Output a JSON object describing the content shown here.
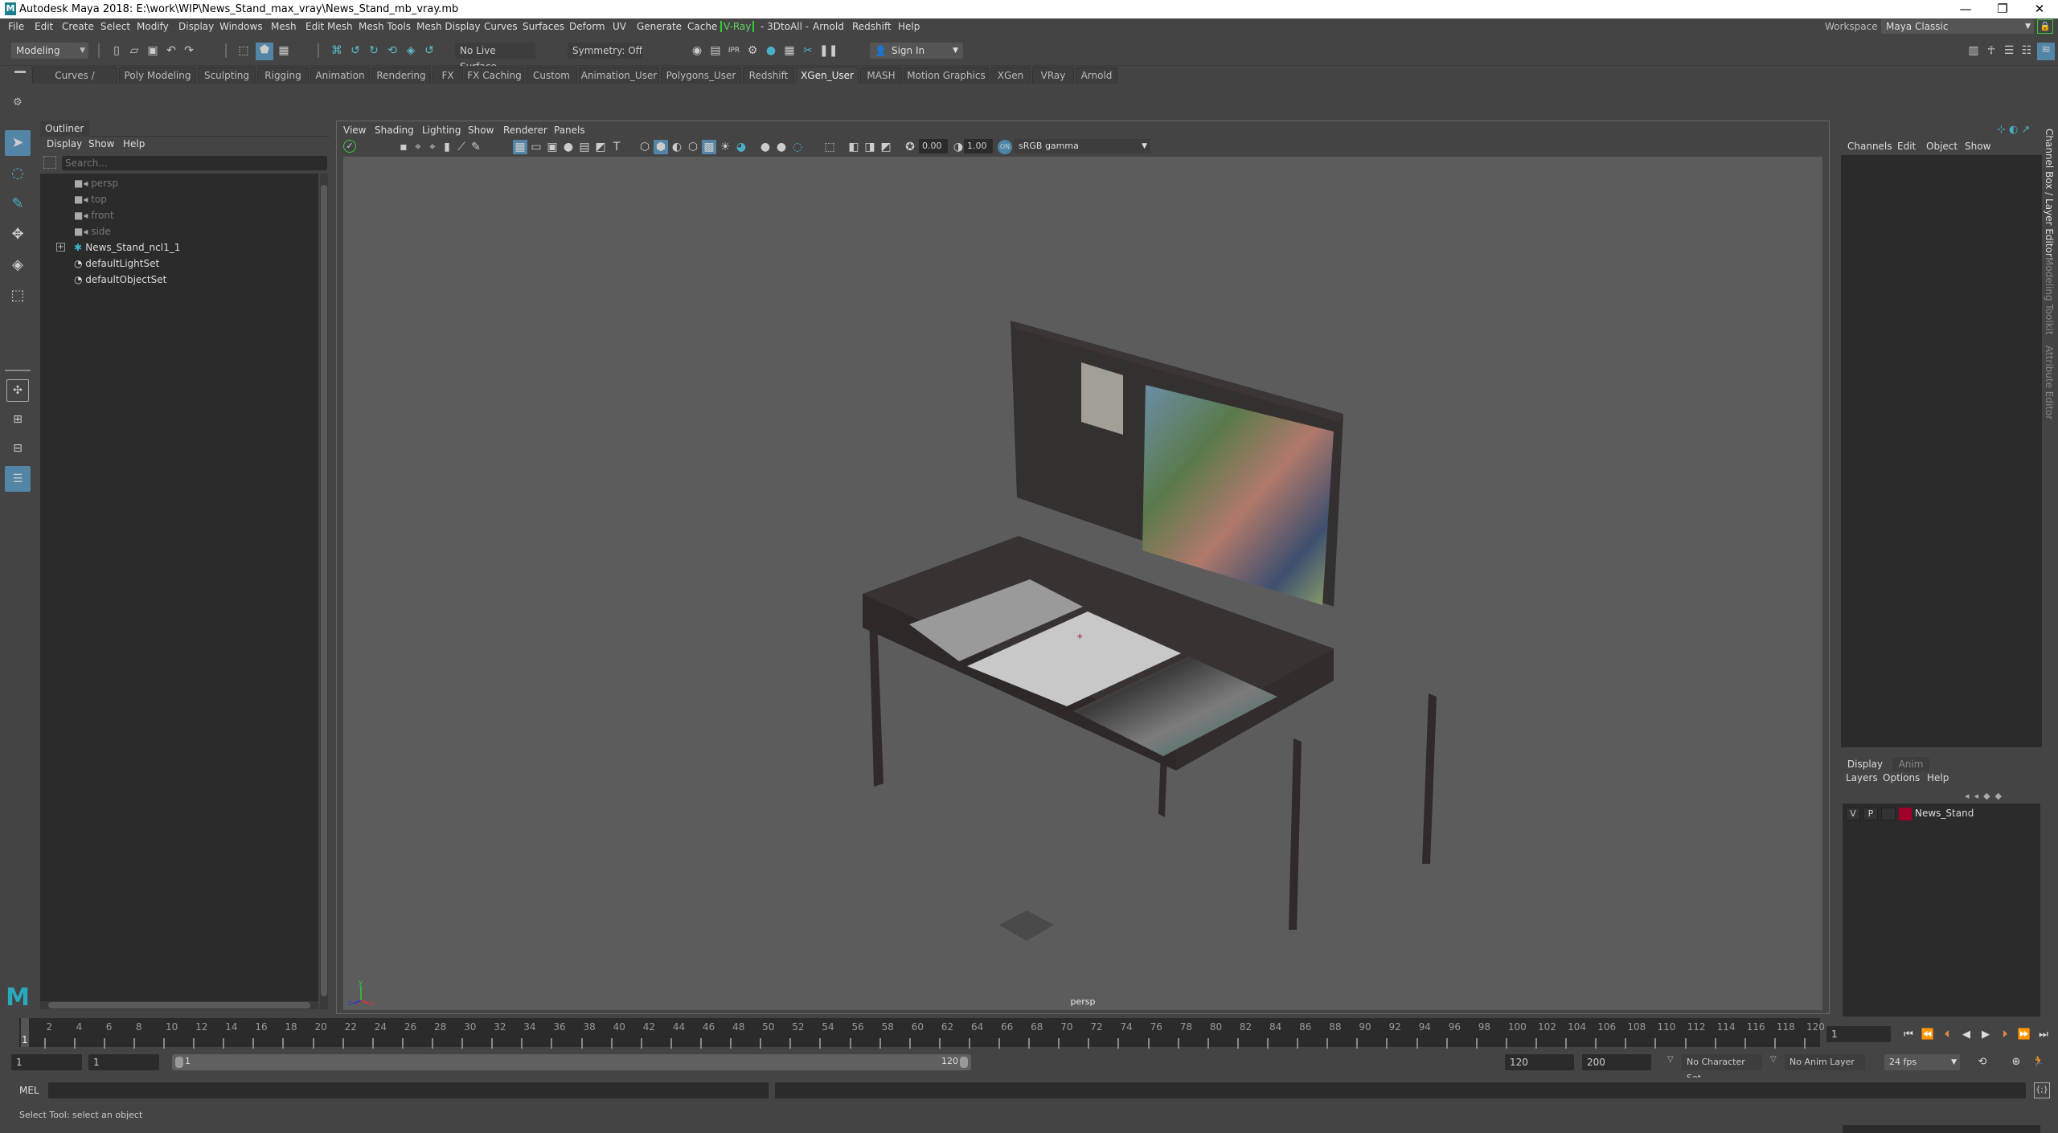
{
  "window": {
    "title": "Autodesk Maya 2018: E:\\work\\WIP\\News_Stand_max_vray\\News_Stand_mb_vray.mb",
    "logo": "M",
    "controls": {
      "minimize": "—",
      "restore": "❐",
      "close": "✕"
    }
  },
  "menubar": {
    "items": [
      "File",
      "Edit",
      "Create",
      "Select",
      "Modify",
      "Display",
      "Windows",
      "Mesh",
      "Edit Mesh",
      "Mesh Tools",
      "Mesh Display",
      "Curves",
      "Surfaces",
      "Deform",
      "UV",
      "Generate",
      "Cache",
      "V-Ray",
      "- 3DtoAll -",
      "Arnold",
      "Redshift",
      "Help"
    ],
    "workspace_label": "Workspace :",
    "workspace_value": "Maya Classic"
  },
  "toolbar": {
    "mode": "Modeling",
    "live_surface": "No Live Surface",
    "symmetry": "Symmetry: Off",
    "sign_in": "Sign In"
  },
  "shelf": {
    "tabs": [
      "Curves / Surfaces",
      "Poly Modeling",
      "Sculpting",
      "Rigging",
      "Animation",
      "Rendering",
      "FX",
      "FX Caching",
      "Custom",
      "Animation_User",
      "Polygons_User",
      "Redshift",
      "XGen_User",
      "MASH",
      "Motion Graphics",
      "XGen",
      "VRay",
      "Arnold"
    ],
    "active_tab": "XGen_User"
  },
  "outliner": {
    "title": "Outliner",
    "menu": [
      "Display",
      "Show",
      "Help"
    ],
    "search_placeholder": "Search...",
    "items": [
      {
        "name": "persp",
        "type": "camera",
        "dim": true
      },
      {
        "name": "top",
        "type": "camera",
        "dim": true
      },
      {
        "name": "front",
        "type": "camera",
        "dim": true
      },
      {
        "name": "side",
        "type": "camera",
        "dim": true
      },
      {
        "name": "News_Stand_ncl1_1",
        "type": "group",
        "dim": false,
        "expandable": true
      },
      {
        "name": "defaultLightSet",
        "type": "set",
        "dim": false
      },
      {
        "name": "defaultObjectSet",
        "type": "set",
        "dim": false
      }
    ]
  },
  "viewport": {
    "menu": [
      "View",
      "Shading",
      "Lighting",
      "Show",
      "Renderer",
      "Panels"
    ],
    "exposure": "0.00",
    "gamma": "1.00",
    "color_space": "sRGB gamma",
    "camera_label": "persp",
    "axis": {
      "x": "x",
      "y": "y",
      "z": "z"
    }
  },
  "channelbox": {
    "menu": [
      "Channels",
      "Edit",
      "Object",
      "Show"
    ],
    "layer_tabs": [
      "Display",
      "Anim"
    ],
    "active_layer_tab": "Display",
    "layer_menu": [
      "Layers",
      "Options",
      "Help"
    ],
    "layers": [
      {
        "v": "V",
        "p": "P",
        "name": "News_Stand",
        "color": "#a0002a"
      }
    ]
  },
  "side_tabs": [
    "Channel Box / Layer Editor",
    "Modeling Toolkit",
    "Attribute Editor"
  ],
  "timeline": {
    "ticks": [
      "2",
      "4",
      "6",
      "8",
      "10",
      "12",
      "14",
      "16",
      "18",
      "20",
      "22",
      "24",
      "26",
      "28",
      "30",
      "32",
      "34",
      "36",
      "38",
      "40",
      "42",
      "44",
      "46",
      "48",
      "50",
      "52",
      "54",
      "56",
      "58",
      "60",
      "62",
      "64",
      "66",
      "68",
      "70",
      "72",
      "74",
      "76",
      "78",
      "80",
      "82",
      "84",
      "86",
      "88",
      "90",
      "92",
      "94",
      "96",
      "98",
      "100",
      "102",
      "104",
      "106",
      "108",
      "110",
      "112",
      "114",
      "116",
      "118",
      "120"
    ],
    "current_frame_marker": "1",
    "current_frame": "1"
  },
  "range": {
    "start": "1",
    "playback_start": "1",
    "slider_start": "1",
    "slider_end": "120",
    "playback_end": "120",
    "end": "200",
    "character_set": "No Character Set",
    "anim_layer": "No Anim Layer",
    "fps": "24 fps"
  },
  "cmdline": {
    "label": "MEL"
  },
  "helpline": {
    "text": "Select Tool: select an object"
  }
}
